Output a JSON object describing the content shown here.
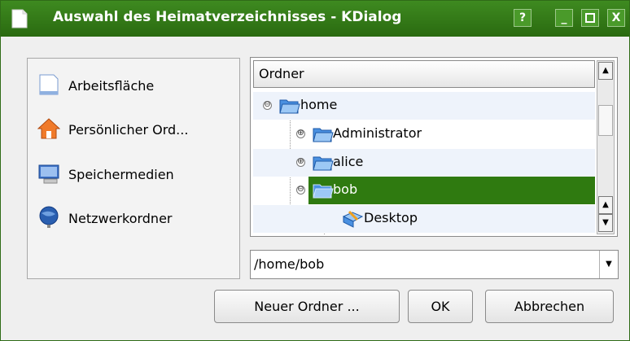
{
  "window": {
    "title": "Auswahl des Heimatverzeichnisses - KDialog",
    "buttons": {
      "help": "?",
      "minimize": "_",
      "maximize": "□",
      "close": "X"
    }
  },
  "places": [
    {
      "label": "Arbeitsfläche",
      "icon": "desktop-icon"
    },
    {
      "label": "Persönlicher Ord...",
      "icon": "home-icon"
    },
    {
      "label": "Speichermedien",
      "icon": "storage-icon"
    },
    {
      "label": "Netzwerkordner",
      "icon": "network-icon"
    }
  ],
  "tree": {
    "header": "Ordner",
    "items": [
      {
        "label": "home",
        "expander": "⊖"
      },
      {
        "label": "Administrator",
        "expander": "⊕"
      },
      {
        "label": "alice",
        "expander": "⊕"
      },
      {
        "label": "bob",
        "expander": "⊖",
        "selected": true
      },
      {
        "label": "Desktop"
      }
    ]
  },
  "path": {
    "value": "/home/bob"
  },
  "actions": {
    "new_folder": "Neuer Ordner ...",
    "ok": "OK",
    "cancel": "Abbrechen"
  },
  "colors": {
    "titlebar": "#2f7a10",
    "selection": "#2f7a10",
    "alt_row": "#eef3fb"
  }
}
